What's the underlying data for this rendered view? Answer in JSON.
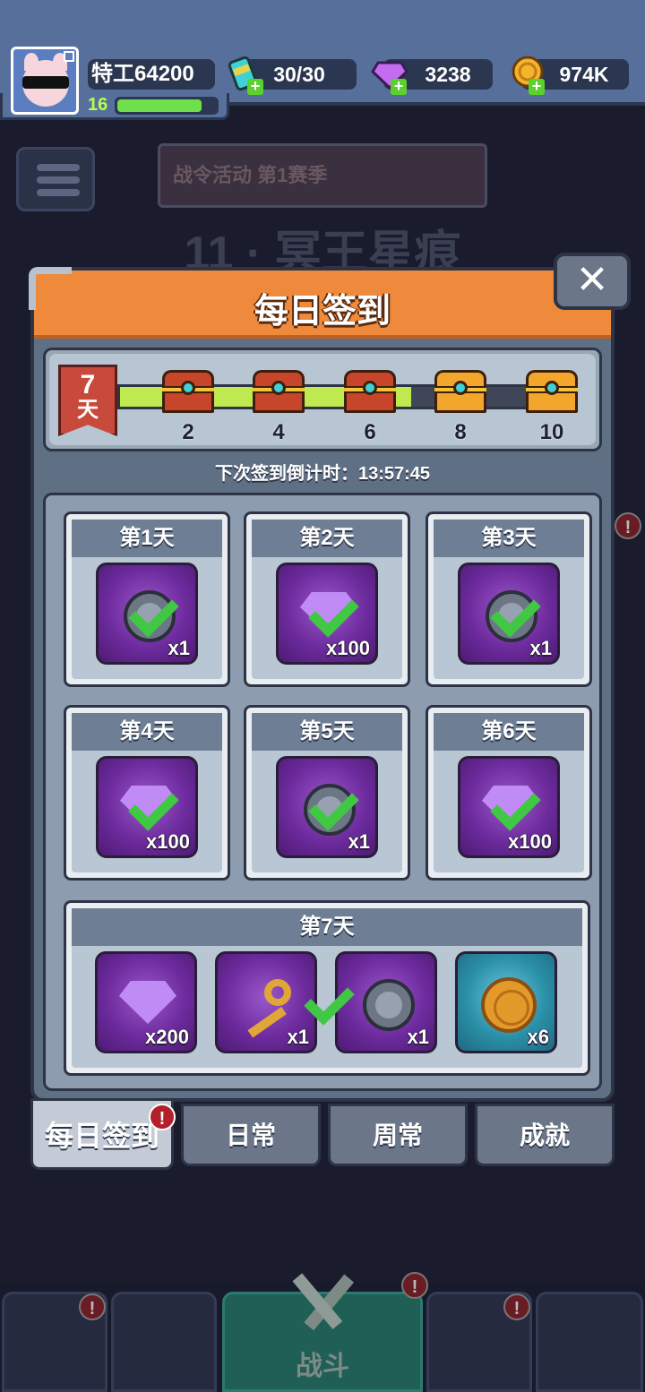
{
  "player": {
    "name": "特工64200",
    "level": "16",
    "xp_fraction": 0.85
  },
  "resources": {
    "energy": "30/30",
    "gems": "3238",
    "gold": "974K"
  },
  "background": {
    "event_banner": "战令活动 第1赛季",
    "stage_title": "11 · 冥王星痕",
    "battle_label": "战斗"
  },
  "modal": {
    "title": "每日签到",
    "close_label": "✕",
    "current_days": "7",
    "days_unit": "天",
    "progress_fraction": 0.645,
    "milestones": [
      {
        "label": "2",
        "type": "red"
      },
      {
        "label": "4",
        "type": "red"
      },
      {
        "label": "6",
        "type": "red"
      },
      {
        "label": "8",
        "type": "gold"
      },
      {
        "label": "10",
        "type": "gold"
      }
    ],
    "countdown": "下次签到倒计时：13:57:45",
    "days": [
      {
        "label": "第1天",
        "item": "coin",
        "qty": "x1",
        "claimed": true
      },
      {
        "label": "第2天",
        "item": "gem",
        "qty": "x100",
        "claimed": true
      },
      {
        "label": "第3天",
        "item": "coin",
        "qty": "x1",
        "claimed": true
      },
      {
        "label": "第4天",
        "item": "gem",
        "qty": "x100",
        "claimed": true
      },
      {
        "label": "第5天",
        "item": "coin",
        "qty": "x1",
        "claimed": true
      },
      {
        "label": "第6天",
        "item": "gem",
        "qty": "x100",
        "claimed": true
      }
    ],
    "day7": {
      "label": "第7天",
      "items": [
        {
          "item": "gem",
          "qty": "x200"
        },
        {
          "item": "key",
          "qty": "x1"
        },
        {
          "item": "coin",
          "qty": "x1"
        },
        {
          "item": "gold-coin",
          "qty": "x6"
        }
      ]
    }
  },
  "tabs": [
    {
      "label": "每日签到",
      "active": true,
      "alert": "!"
    },
    {
      "label": "日常",
      "active": false
    },
    {
      "label": "周常",
      "active": false
    },
    {
      "label": "成就",
      "active": false
    }
  ],
  "nav_alerts": [
    "!",
    "!",
    "!",
    "!"
  ],
  "colors": {
    "header_orange": "#ef8a3c",
    "progress_green": "#bfe94e",
    "check_green": "#40c744",
    "slot_purple": "#6d2b9e",
    "alert_red": "#b3202c"
  }
}
